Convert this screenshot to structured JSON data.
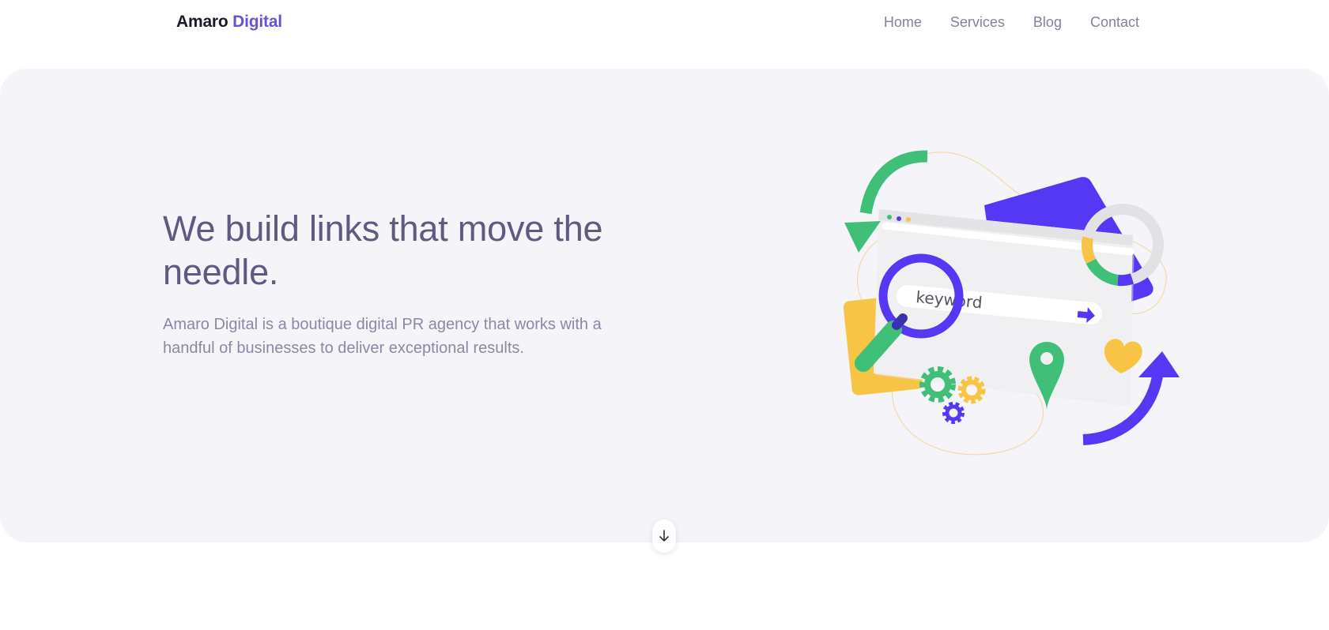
{
  "brand": {
    "name_part1": "Amaro",
    "name_part2": "Digital"
  },
  "nav": {
    "items": [
      {
        "label": "Home"
      },
      {
        "label": "Services"
      },
      {
        "label": "Blog"
      },
      {
        "label": "Contact"
      }
    ]
  },
  "hero": {
    "title": "We build links that move the needle.",
    "description": "Amaro Digital is a boutique digital PR agency that works with a handful of businesses to deliver exceptional results.",
    "illustration": {
      "search_text": "keyword",
      "icons": [
        "refresh-arrow-icon",
        "magnifier-icon",
        "browser-window-icon",
        "donut-chart-icon",
        "gear-icon",
        "location-pin-icon",
        "heart-icon",
        "growth-arrow-icon"
      ]
    }
  },
  "scroll_down": {
    "icon": "arrow-down-icon"
  },
  "colors": {
    "accent": "#6a50d8",
    "purple": "#5538f3",
    "green": "#3fbf77",
    "yellow": "#f8c445",
    "hero_bg": "#f4f4f9",
    "title": "#5e5a80",
    "text": "#8c88a3",
    "nav": "#85819a"
  }
}
